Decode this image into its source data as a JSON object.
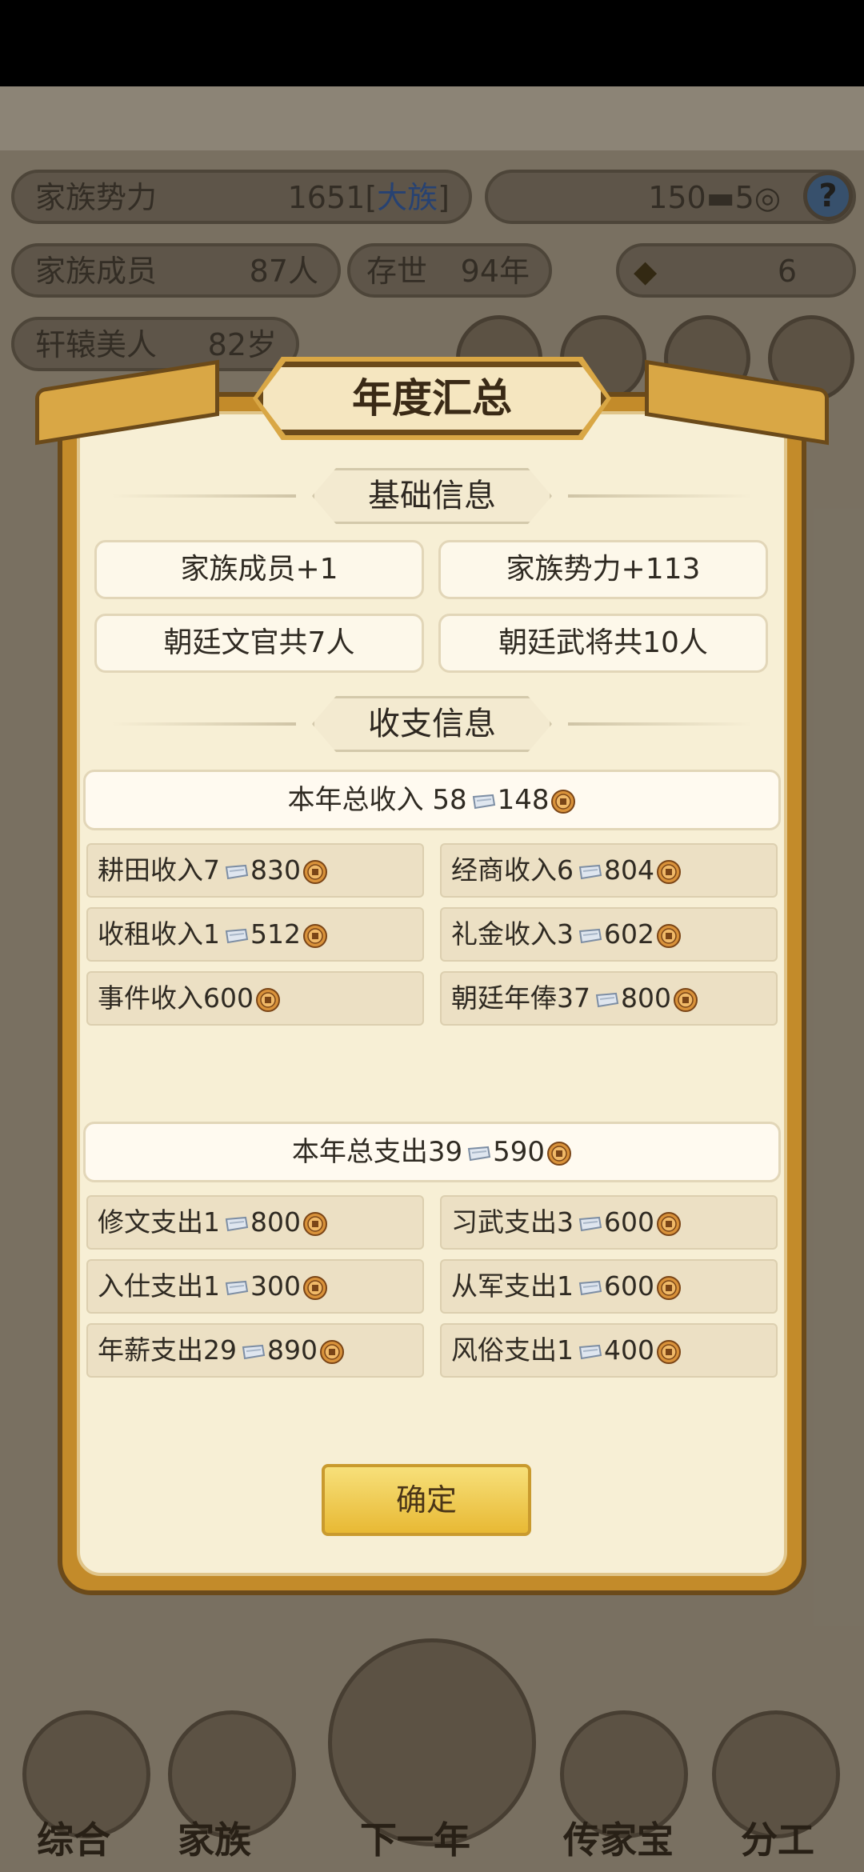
{
  "hud": {
    "family_power_label": "家族势力",
    "family_power_value": "1651",
    "family_power_rank": "大族",
    "silver_value": "150",
    "coin_value": "5",
    "help_icon": "question-icon",
    "members_label": "家族成员",
    "members_value": "87人",
    "alive_label": "存世",
    "alive_value": "94年",
    "gold_value": "6",
    "person_name": "轩辕美人",
    "person_age": "82岁"
  },
  "bottom_nav": [
    "综合",
    "家族",
    "下一年",
    "传家宝",
    "分工"
  ],
  "modal": {
    "title": "年度汇总",
    "basic_section": "基础信息",
    "basic_items": [
      "家族成员+1",
      "家族势力+113",
      "朝廷文官共7人",
      "朝廷武将共10人"
    ],
    "finance_section": "收支信息",
    "income_total": {
      "label": "本年总收入 ",
      "silver": "58",
      "coin": "148"
    },
    "income_items": [
      {
        "label": "耕田收入",
        "silver": "7",
        "coin": "830"
      },
      {
        "label": "经商收入",
        "silver": "6",
        "coin": "804"
      },
      {
        "label": "收租收入",
        "silver": "1",
        "coin": "512"
      },
      {
        "label": "礼金收入",
        "silver": "3",
        "coin": "602"
      },
      {
        "label": "事件收入",
        "silver": "",
        "coin": "600"
      },
      {
        "label": "朝廷年俸",
        "silver": "37",
        "coin": "800"
      }
    ],
    "expense_total": {
      "label": "本年总支出",
      "silver": "39",
      "coin": "590"
    },
    "expense_items": [
      {
        "label": "修文支出",
        "silver": "1",
        "coin": "800"
      },
      {
        "label": "习武支出",
        "silver": "3",
        "coin": "600"
      },
      {
        "label": "入仕支出",
        "silver": "1",
        "coin": "300"
      },
      {
        "label": "从军支出",
        "silver": "1",
        "coin": "600"
      },
      {
        "label": "年薪支出",
        "silver": "29",
        "coin": "890"
      },
      {
        "label": "风俗支出",
        "silver": "1",
        "coin": "400"
      }
    ],
    "confirm_label": "确定"
  },
  "colors": {
    "accent_gold": "#e8b934",
    "panel_bg": "#f7efd5",
    "frame": "#c38b2a"
  }
}
